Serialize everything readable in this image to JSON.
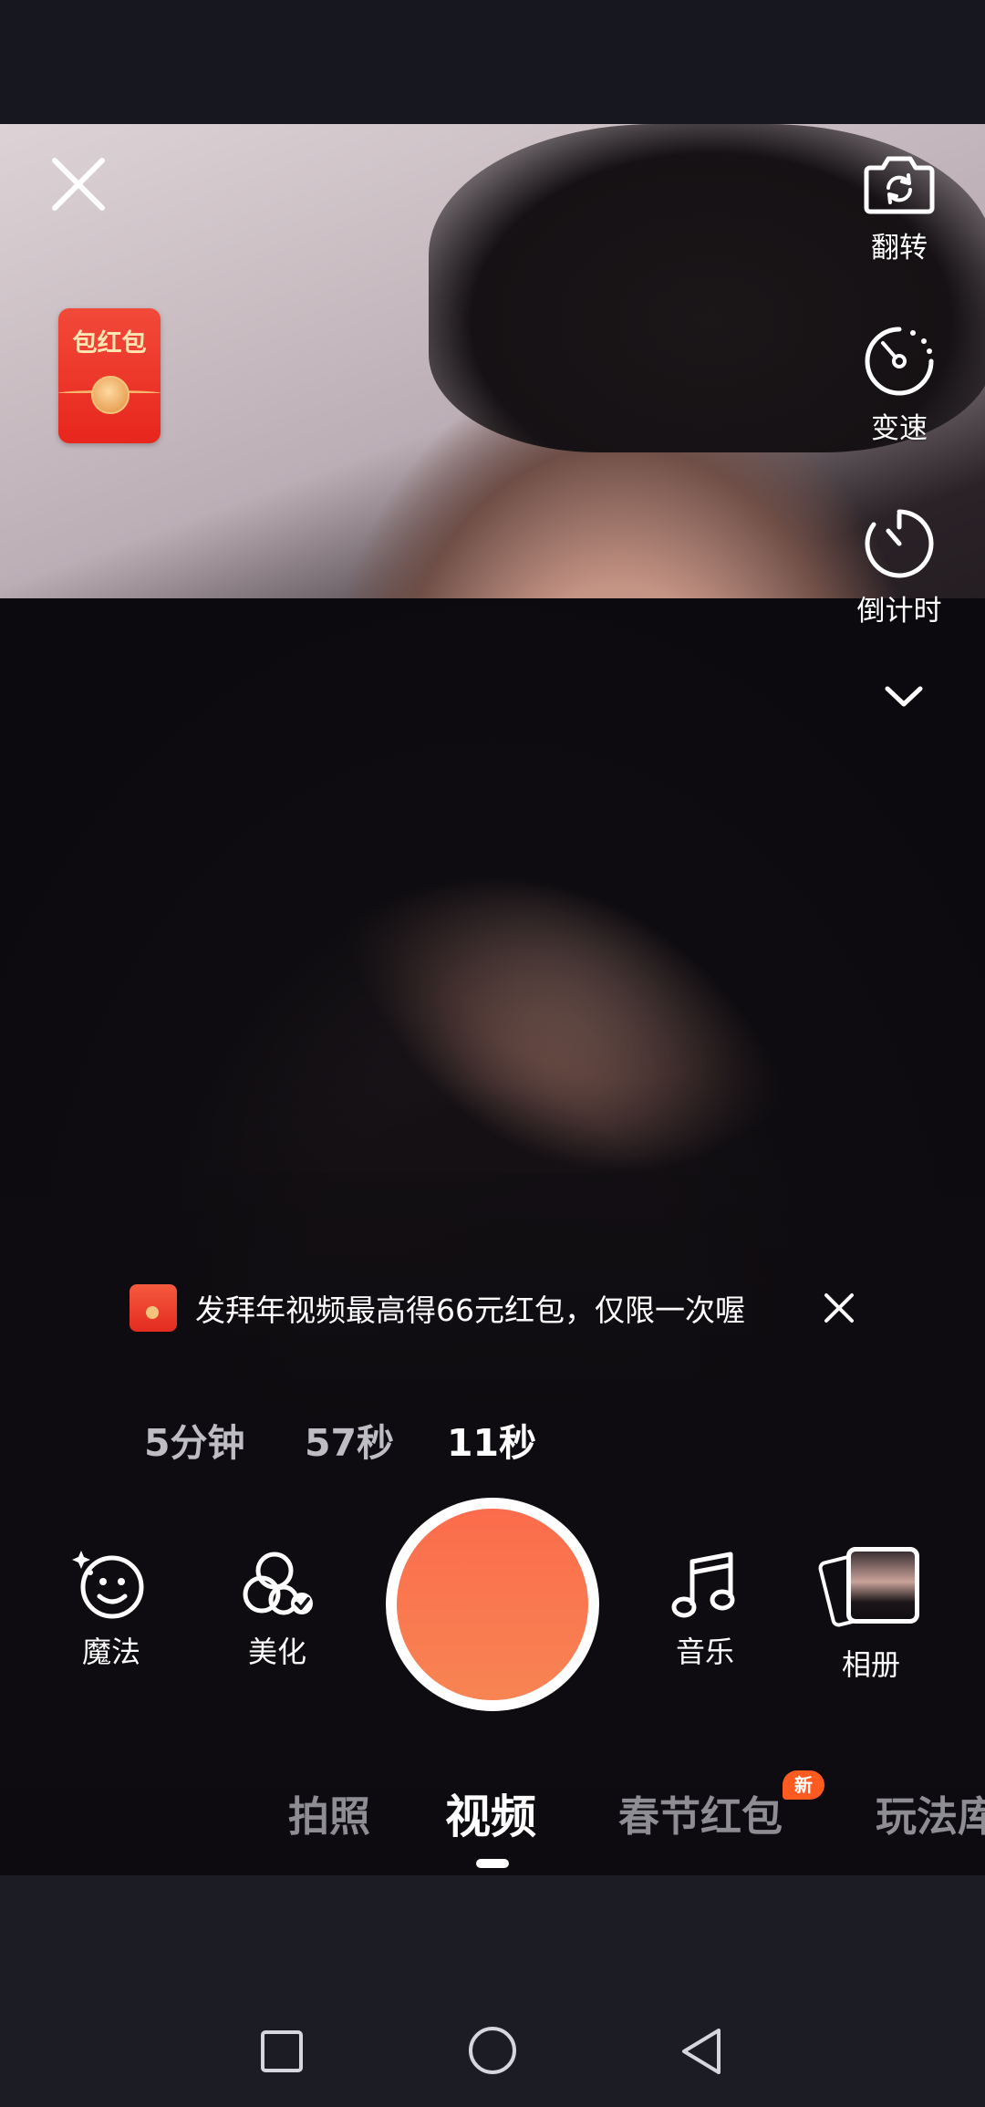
{
  "camera_tools": {
    "flip_label": "翻转",
    "speed_label": "变速",
    "countdown_label": "倒计时"
  },
  "hongbao_widget": {
    "label": "包红包"
  },
  "promo_banner": {
    "text": "发拜年视频最高得66元红包，仅限一次喔"
  },
  "durations": [
    "5分钟",
    "57秒",
    "11秒"
  ],
  "selected_duration": "11秒",
  "bottom_tools": {
    "magic_label": "魔法",
    "beautify_label": "美化",
    "music_label": "音乐",
    "album_label": "相册"
  },
  "modes": [
    "拍照",
    "视频",
    "春节红包",
    "玩法库"
  ],
  "active_mode": "视频",
  "new_badge": "新",
  "colors": {
    "shutter": "#fa7650",
    "badge": "#ff5a1f",
    "hongbao": "#e8261e"
  },
  "icons": {
    "close": "close-icon",
    "flip": "camera-flip-icon",
    "speed": "speedometer-icon",
    "countdown": "timer-icon",
    "expand": "chevron-down-icon",
    "magic": "magic-face-icon",
    "beautify": "beautify-icon",
    "music": "music-note-icon",
    "album": "album-thumbnail-icon",
    "nav_recent": "square-icon",
    "nav_home": "circle-icon",
    "nav_back": "triangle-back-icon"
  }
}
